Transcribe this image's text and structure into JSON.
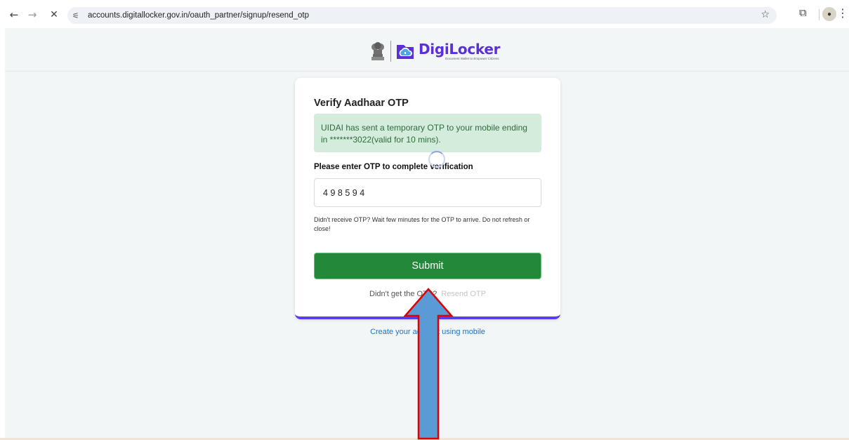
{
  "browser": {
    "url": "accounts.digitallocker.gov.in/oauth_partner/signup/resend_otp",
    "back_icon": "arrow-left-icon",
    "forward_icon": "arrow-right-icon",
    "stop_icon": "close-icon",
    "site_info_icon": "tune-icon",
    "bookmark_icon": "star-icon",
    "extensions_icon": "puzzle-icon",
    "profile_icon": "avatar-icon",
    "menu_icon": "more-vertical-icon"
  },
  "header": {
    "brand": "DigiLocker",
    "tagline": "Document Wallet to Empower Citizens"
  },
  "card": {
    "title": "Verify Aadhaar OTP",
    "alert_text": "UIDAI has sent a temporary OTP to your mobile ending in *******3022(valid for 10 mins).",
    "otp_label": "Please enter OTP to complete verification",
    "otp_value": "498594",
    "help_text": "Didn't receive OTP? Wait few minutes for the OTP to arrive. Do not refresh or close!",
    "submit_label": "Submit",
    "resend_prefix": "Didn't get the OTP?",
    "resend_link": "Resend OTP"
  },
  "footer": {
    "create_link": "Create your account using mobile"
  },
  "colors": {
    "primary_button": "#23883a",
    "alert_bg": "#d4ecdb",
    "brand_purple": "#5b30d6",
    "card_accent": "#5b3df0",
    "link_blue": "#1a73c9",
    "arrow_fill": "#5b9bd5",
    "arrow_outline": "#e00000"
  }
}
